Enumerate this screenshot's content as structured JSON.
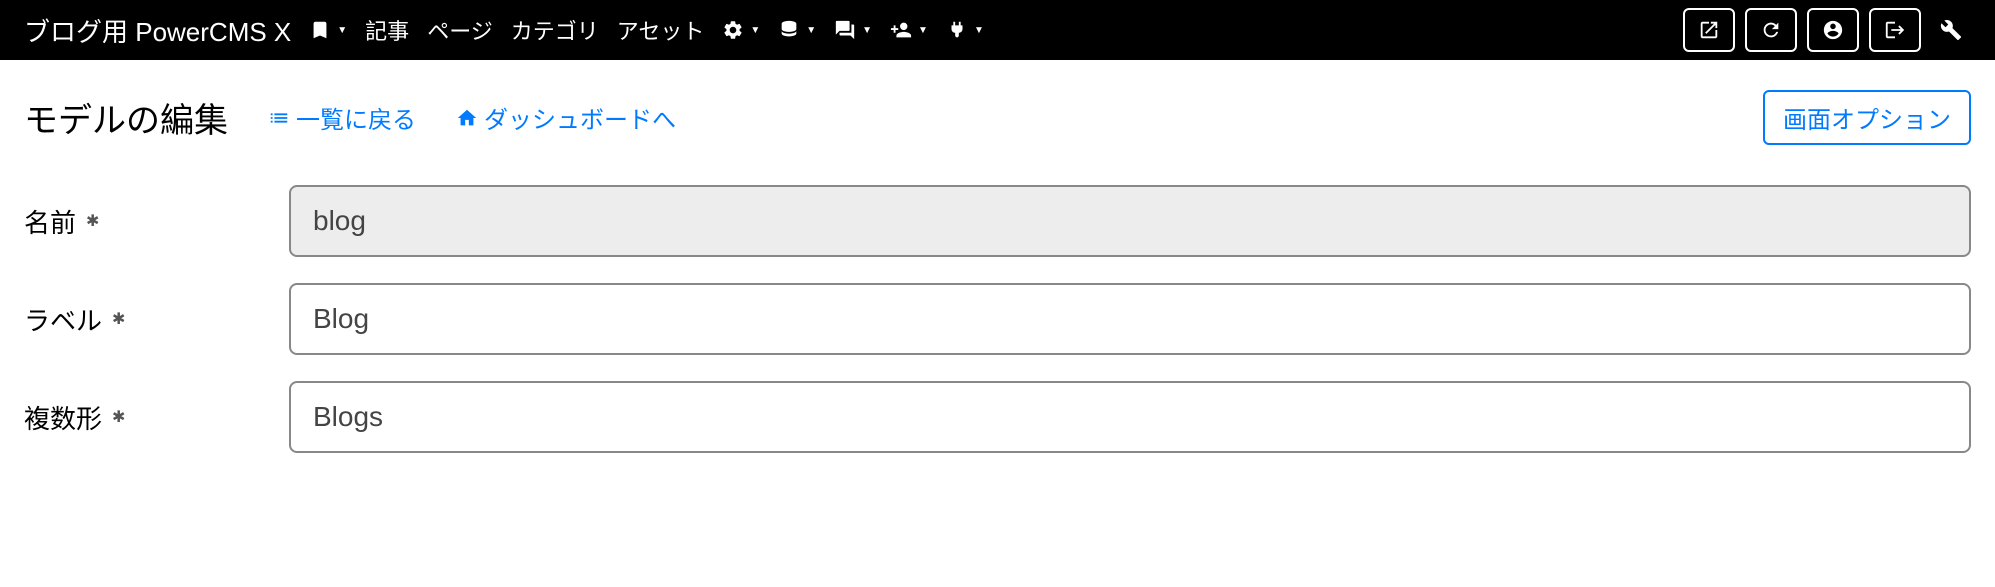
{
  "navbar": {
    "brand": "ブログ用 PowerCMS X",
    "items": [
      "記事",
      "ページ",
      "カテゴリ",
      "アセット"
    ]
  },
  "page": {
    "title": "モデルの編集",
    "back_to_list": "一覧に戻る",
    "to_dashboard": "ダッシュボードへ",
    "screen_options": "画面オプション"
  },
  "form": {
    "name": {
      "label": "名前",
      "value": "blog"
    },
    "label": {
      "label": "ラベル",
      "value": "Blog"
    },
    "plural": {
      "label": "複数形",
      "value": "Blogs"
    }
  }
}
